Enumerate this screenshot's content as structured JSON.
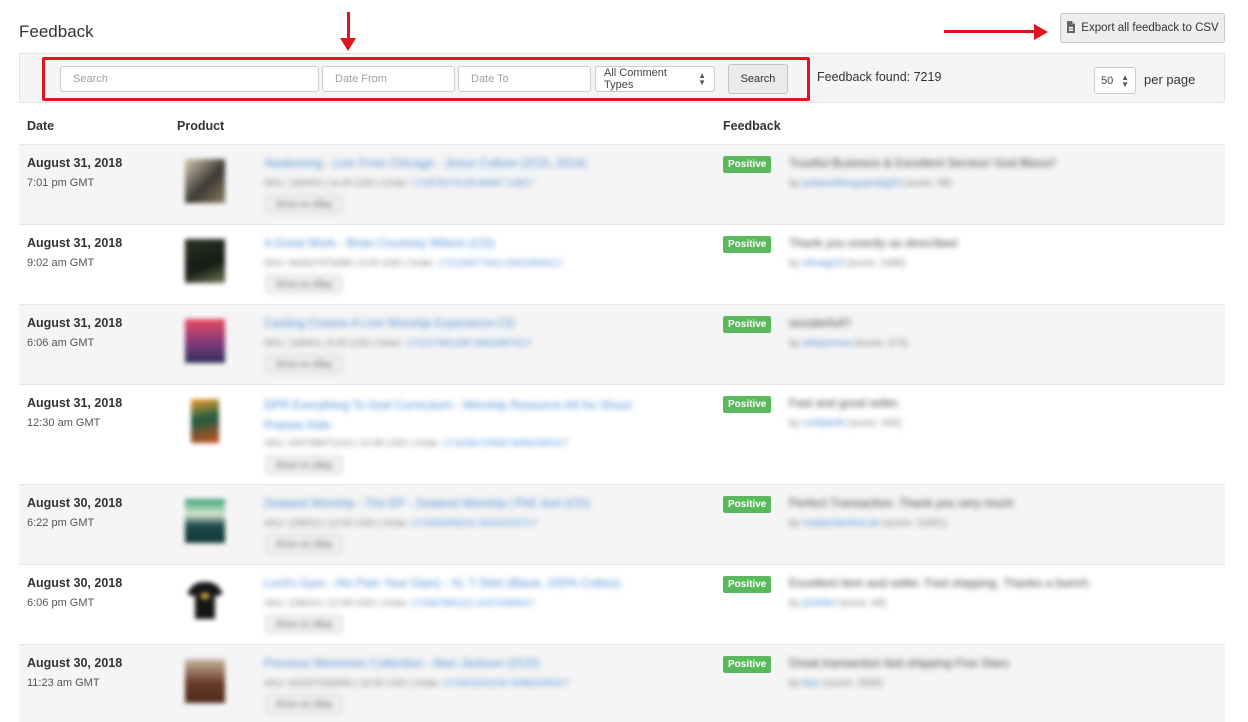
{
  "header": {
    "title": "Feedback",
    "export_label": "Export all feedback to CSV",
    "export_icon": "file-export-icon"
  },
  "filters": {
    "search_placeholder": "Search",
    "date_from_placeholder": "Date From",
    "date_to_placeholder": "Date To",
    "comment_type_selected": "All Comment Types",
    "search_button": "Search",
    "found_text": "Feedback found: 7219",
    "per_page_value": "50",
    "per_page_label": "per page"
  },
  "annotations": {
    "highlight_color": "#e0141e"
  },
  "table": {
    "headers": {
      "date": "Date",
      "product": "Product",
      "feedback": "Feedback"
    },
    "show_on_ebay_label": "Show on eBay",
    "badge_color": "#5cb85c",
    "rows": [
      {
        "date": "August 31, 2018",
        "time": "7:01 pm GMT",
        "product": "Awakening - Live From Chicago - Jesus Culture (2CD, 2014)",
        "meta": "SKU: 235403 | 14.00 USD | Order: ",
        "order": "172878279128-89997 14817",
        "badge": "Positive",
        "comment": "Trustful Business & Excellent Service! God Bless!!",
        "by": "by ",
        "user": "justanotherguyinatg20",
        "score": " (score: 48)"
      },
      {
        "date": "August 31, 2018",
        "time": "9:02 am GMT",
        "product": "A Great Work - Brian Courtney Wilson (CD)",
        "meta": "SKU: 802507975089 | 9.00 USD | Order: ",
        "order": "172130577402-20922990017",
        "badge": "Positive",
        "comment": "Thank you exactly as described",
        "by": "by ",
        "user": "rdmagi10",
        "score": " (score: 1080)"
      },
      {
        "date": "August 31, 2018",
        "time": "6:06 am GMT",
        "product": "Casting Crowns A Live Worship Experience CD",
        "meta": "SKU: 228401 | 8.45 USD | Order: ",
        "order": "172127981268-30816807617",
        "badge": "Positive",
        "comment": "wonderful!!!",
        "by": "by ",
        "user": "adriyemma",
        "score": " (score: 474)"
      },
      {
        "date": "August 31, 2018",
        "time": "12:30 am GMT",
        "product": "DPR Everything To God Curriculum - Worship Resource Kit for Shout Praises Kids",
        "meta": "SKU: 000768071210 | 14.95 USD | Order: ",
        "order": "173228170936-30992390417",
        "badge": "Positive",
        "comment": "Fast and good seller.",
        "by": "by ",
        "user": "rcollybeth",
        "score": " (score: 440)"
      },
      {
        "date": "August 30, 2018",
        "time": "6:22 pm GMT",
        "product": "Zealand Worship - The EP - Zealand Worship | Phil Joel (CD)",
        "meta": "SKU: 228913 | 14.50 USD | Order: ",
        "order": "173305058216-30202200717",
        "badge": "Positive",
        "comment": "Perfect Transaction. Thank you very much",
        "by": "by ",
        "user": "readamberline.de",
        "score": " (score: 11651)"
      },
      {
        "date": "August 30, 2018",
        "time": "6:06 pm GMT",
        "product": "Lord's Gym - His Pain Your Gain) - XL T-Shirt (Black, 100% Cotton)",
        "meta": "SKU: 228014 | 12.99 USD | Order: ",
        "order": "173367881111-20376280917",
        "badge": "Positive",
        "comment": "Excellent item and seller. Fast shipping. Thanks a bunch.",
        "by": "by ",
        "user": "jt2408rt",
        "score": " (score: 96)"
      },
      {
        "date": "August 30, 2018",
        "time": "11:23 am GMT",
        "product": "Precious Memories Collection - Alan Jackson (2CD)",
        "meta": "SKU: 602507536090 | 16.95 USD | Order: ",
        "order": "172903202249-30982290917",
        "badge": "Positive",
        "comment": "Great transaction fast shipping Five Stars",
        "by": "by ",
        "user": "faxu",
        "score": " (score: 2600)"
      }
    ]
  }
}
